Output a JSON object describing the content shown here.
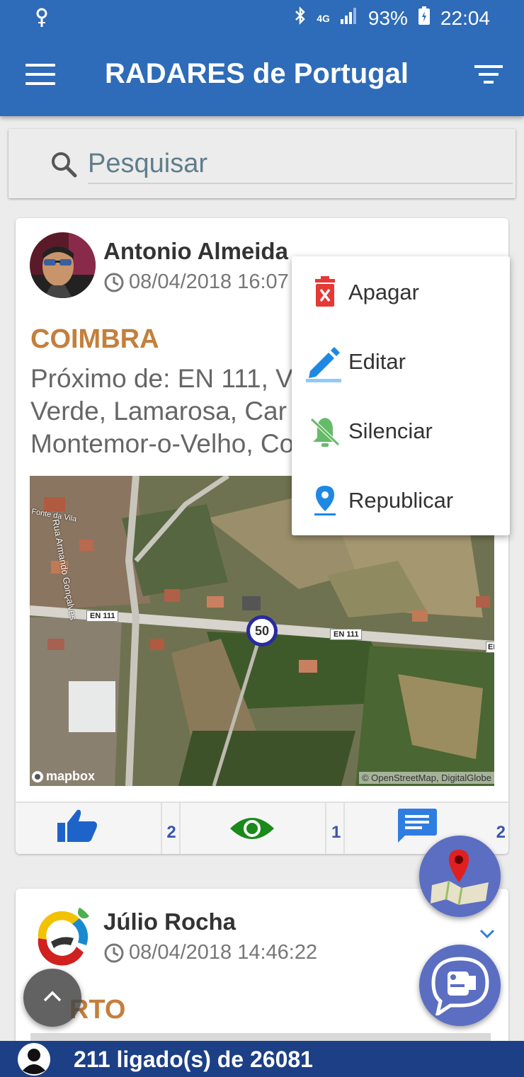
{
  "status_bar": {
    "signal": "4G",
    "battery": "93%",
    "time": "22:04"
  },
  "header": {
    "title": "RADARES de Portugal"
  },
  "search": {
    "placeholder": "Pesquisar"
  },
  "posts": [
    {
      "author": "Antonio Almeida",
      "timestamp": "08/04/2018 16:07",
      "city": "COIMBRA",
      "address": "Próximo de: EN 111, V… Verde, Lamarosa, Car… Montemor-o-Velho, C…",
      "address_lines": [
        "Próximo de: EN 111, V",
        "Verde, Lamarosa, Car",
        "Montemor-o-Velho, Co"
      ],
      "map": {
        "road_label_1": "EN 111",
        "road_label_2": "EN 111",
        "road_label_3": "EN",
        "street_label_1": "Rua Armando Gonçalves",
        "street_label_2": "Fonte da Vila",
        "speed_limit": "50",
        "provider": "mapbox",
        "attribution": "© OpenStreetMap, DigitalGlobe"
      },
      "likes": "2",
      "views": "1",
      "comments": "2"
    },
    {
      "author": "Júlio Rocha",
      "timestamp": "08/04/2018 14:46:22",
      "city": "PORTO",
      "city_visible": "RTO"
    }
  ],
  "menu": {
    "items": [
      {
        "label": "Apagar",
        "icon": "delete-icon",
        "color": "#e53935"
      },
      {
        "label": "Editar",
        "icon": "edit-icon",
        "color": "#1e88e5"
      },
      {
        "label": "Silenciar",
        "icon": "bell-off-icon",
        "color": "#66bb6a"
      },
      {
        "label": "Republicar",
        "icon": "location-pin-icon",
        "color": "#1e88e5"
      }
    ]
  },
  "footer": {
    "online_text": "211 ligado(s) de 26081"
  },
  "colors": {
    "primary": "#2e6bb8",
    "footer": "#1c3f86",
    "city": "#c47f3c",
    "fab": "#5b6ec2"
  }
}
